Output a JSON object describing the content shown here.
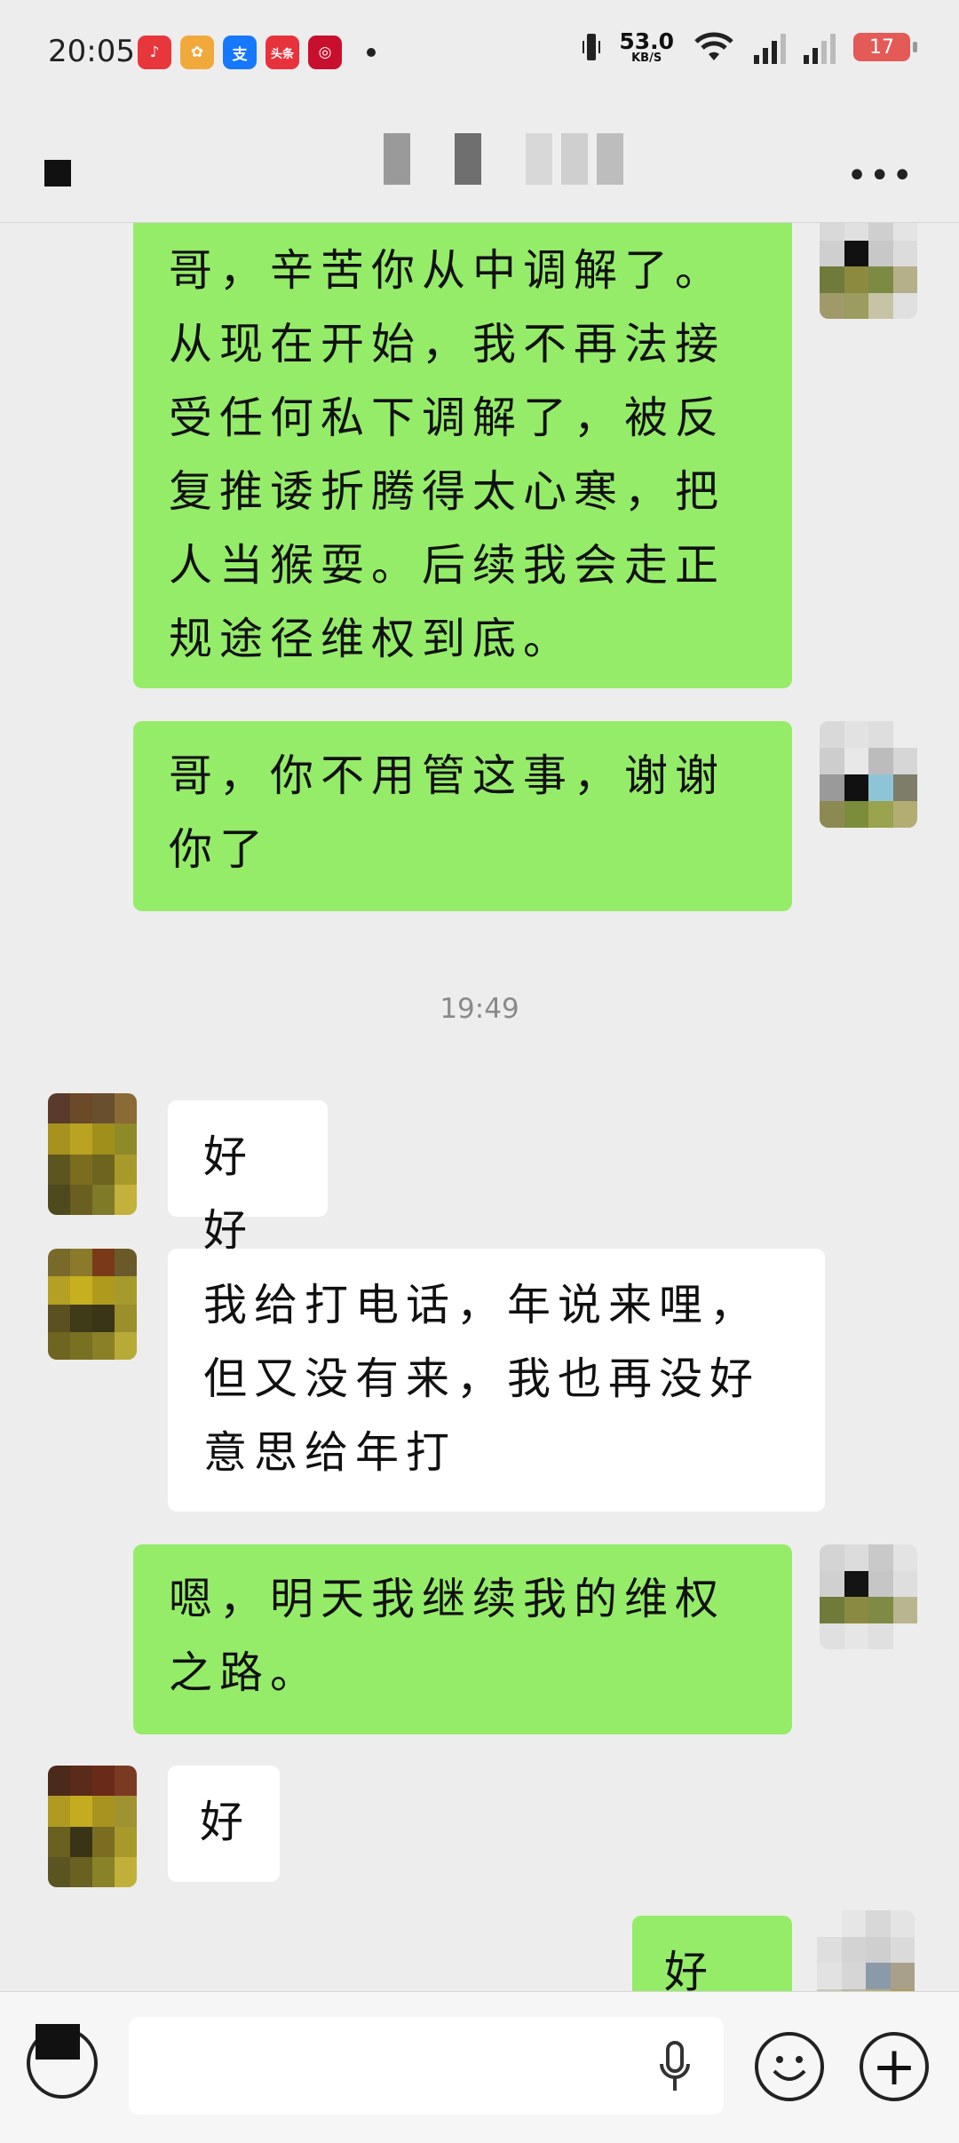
{
  "status_bar": {
    "time": "20:05",
    "net_speed": "53.0",
    "net_unit": "KB/S",
    "sig1": "4G",
    "sig2": "5G",
    "battery": "17",
    "app_icons": [
      {
        "icon": "music-app-icon",
        "color": "#e8363d",
        "glyph": "♪"
      },
      {
        "icon": "photos-app-icon",
        "color": "#f2a93b",
        "glyph": "✿"
      },
      {
        "icon": "alipay-app-icon",
        "color": "#1677ff",
        "glyph": "支"
      },
      {
        "icon": "toutiao-app-icon",
        "color": "#e8323b",
        "glyph": "头条"
      },
      {
        "icon": "bank-app-icon",
        "color": "#c8102e",
        "glyph": "◎"
      }
    ]
  },
  "title_bar": {
    "more_icon": "more-icon",
    "back_icon": "back-icon"
  },
  "messages": [
    {
      "side": "out",
      "text": "哥，辛苦你从中调解了。从现在开始，我不再法接受任何私下调解了，被反复推诿折腾得太心寒，把人当猴耍。后续我会走正规途径维权到底。"
    },
    {
      "side": "out",
      "text": "哥，你不用管这事，谢谢你了"
    },
    {
      "side": "in",
      "text": "好好"
    },
    {
      "side": "in",
      "text": "我给打电话，年说来哩，但又没有来，我也再没好意思给年打"
    },
    {
      "side": "out",
      "text": "嗯，明天我继续我的维权之路。"
    },
    {
      "side": "in",
      "text": "好"
    },
    {
      "side": "out",
      "text": "好的"
    }
  ],
  "timestamp": "19:49",
  "input_bar": {
    "placeholder": "",
    "voice_icon": "voice-mode-icon",
    "mic_icon": "microphone-icon",
    "emoji_icon": "emoji-icon",
    "plus_icon": "plus-icon",
    "plus_glyph": "+"
  }
}
